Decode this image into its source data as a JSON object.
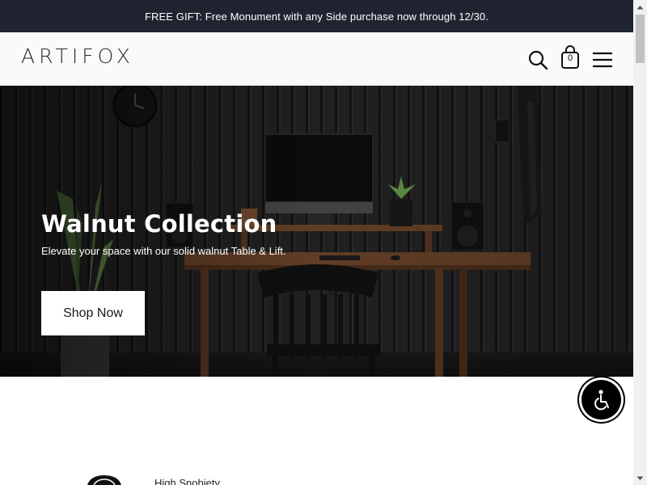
{
  "announcement": {
    "text": "FREE GIFT: Free Monument with any Side purchase now through 12/30."
  },
  "header": {
    "logo": "ARTIFOX",
    "cart_count": "0",
    "icons": [
      "search-icon",
      "cart-icon",
      "menu-icon"
    ]
  },
  "hero": {
    "title": "Walnut Collection",
    "subtitle": "Elevate your space with our solid walnut Table & Lift.",
    "cta_label": "Shop Now"
  },
  "accessibility": {
    "icon": "accessibility-icon"
  },
  "press": {
    "name": "High Snobiety"
  },
  "colors": {
    "announcement_bg": "#1f2430",
    "header_bg": "#fafafa",
    "hero_wall": "#1c1c1c",
    "walnut": "#6b4429"
  }
}
